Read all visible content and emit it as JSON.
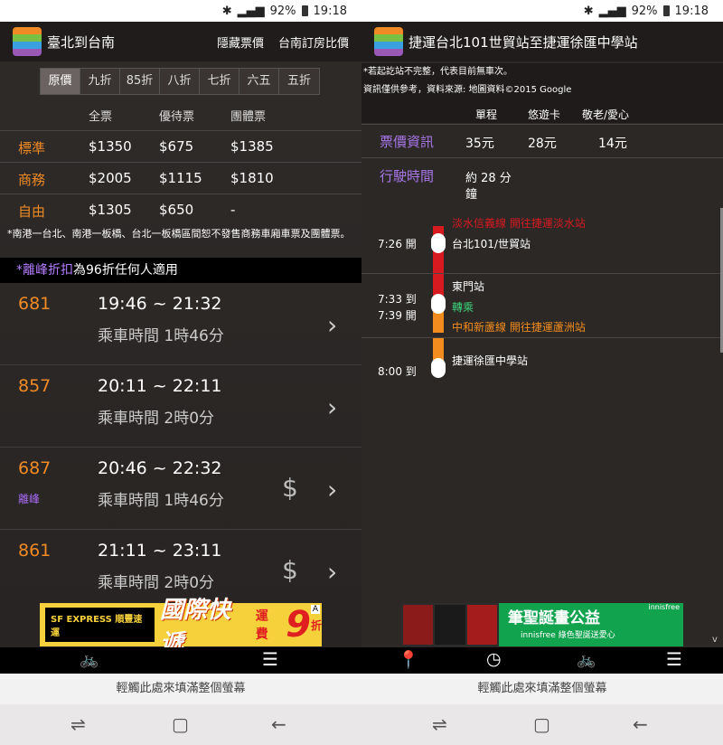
{
  "status": {
    "battery": "92%",
    "time": "19:18"
  },
  "left": {
    "title": "臺北到台南",
    "actions": [
      "隱藏票價",
      "台南訂房比價"
    ],
    "discounts": [
      "原價",
      "九折",
      "85折",
      "八折",
      "七折",
      "六五",
      "五折"
    ],
    "fare_headers": [
      "全票",
      "優待票",
      "團體票"
    ],
    "fares": [
      {
        "class": "標準",
        "full": "$1350",
        "concession": "$675",
        "group": "$1385"
      },
      {
        "class": "商務",
        "full": "$2005",
        "concession": "$1115",
        "group": "$1810"
      },
      {
        "class": "自由",
        "full": "$1305",
        "concession": "$650",
        "group": "-"
      }
    ],
    "note": "*南港一台北、南港一板橋、台北一板橋區間恕不發售商務車廂車票及團體票。",
    "offpeak_label": "*離峰折扣",
    "offpeak_rest": "為96折任何人適用",
    "trains": [
      {
        "no": "681",
        "time": "19:46 ~ 21:32",
        "duration": "乘車時間 1時46分",
        "tag": "",
        "dollar": ""
      },
      {
        "no": "857",
        "time": "20:11 ~ 22:11",
        "duration": "乘車時間 2時0分",
        "tag": "",
        "dollar": ""
      },
      {
        "no": "687",
        "time": "20:46 ~ 22:32",
        "duration": "乘車時間 1時46分",
        "tag": "離峰",
        "dollar": "$"
      },
      {
        "no": "861",
        "time": "21:11 ~ 23:11",
        "duration": "乘車時間 2時0分",
        "tag": "",
        "dollar": "$"
      }
    ],
    "ad": {
      "brand": "SF EXPRESS 順豐速運",
      "headline": "國際快遞",
      "fee": "運費",
      "number": "9",
      "unit": "折",
      "badge": "A"
    },
    "fill_text": "輕觸此處來填滿整個螢幕"
  },
  "right": {
    "title": "捷運台北101世貿站至捷運徐匯中學站",
    "notes": [
      "*若起訖站不完整，代表目前無車次。",
      "資訊僅供參考，資料來源: 地圖資料©2015 Google"
    ],
    "col_headers": [
      "單程",
      "悠遊卡",
      "敬老/愛心"
    ],
    "fare_label": "票價資訊",
    "fares": [
      "35元",
      "28元",
      "14元"
    ],
    "time_label": "行駛時間",
    "time_value_1": "約 28 分",
    "time_value_2": "鐘",
    "stops": {
      "line1_header": "淡水信義線 開往捷運淡水站",
      "t1": "7:26 開",
      "s1": "台北101/世貿站",
      "s2": "東門站",
      "t2a": "7:33 到",
      "t2b": "7:39 開",
      "transfer": "轉乘",
      "line2_header": "中和新蘆線 開往捷運蘆洲站",
      "t3": "8:00 到",
      "s3": "捷運徐匯中學站"
    },
    "ad": {
      "headline": "筆聖誕畫公益",
      "sub": "innisfree 綠色聖誕送愛心",
      "brand": "innisfree"
    },
    "fill_text": "輕觸此處來填滿整個螢幕"
  },
  "colors": {
    "orange": "#f08a24",
    "purple": "#a876e8",
    "red_line": "#d71920",
    "orange_line": "#f28c1e"
  }
}
